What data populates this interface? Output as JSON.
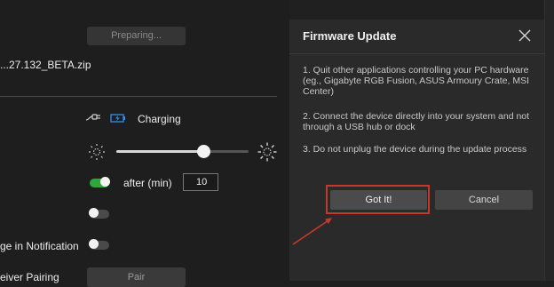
{
  "firmware": {
    "preparing_label": "Preparing...",
    "filename": "...27.132_BETA.zip"
  },
  "power": {
    "charging_label": "Charging",
    "icons": [
      "plug-icon",
      "battery-charging-icon"
    ]
  },
  "brightness": {
    "level_fraction": 0.66,
    "icons": [
      "sun-dim-icon",
      "sun-bright-icon"
    ]
  },
  "sleep": {
    "enabled": true,
    "label": "after (min)",
    "minutes": "10"
  },
  "toggle_unlabeled": {
    "enabled": false
  },
  "notification": {
    "label": "ge in Notification",
    "enabled": false
  },
  "pairing": {
    "label": "eiver Pairing",
    "button_label": "Pair"
  },
  "dialog": {
    "title": "Firmware Update",
    "steps": [
      "1. Quit other applications controlling your PC hardware (eg., Gigabyte RGB Fusion, ASUS Armoury Crate, MSI Center)",
      "2. Connect the device directly into your system and not through a USB hub or dock",
      "3. Do not unplug the device during the update process"
    ],
    "confirm_label": "Got It!",
    "cancel_label": "Cancel"
  },
  "colors": {
    "toggle_on": "#2fa63a",
    "highlight": "#c43a2a",
    "battery_accent": "#3b8ee6"
  }
}
